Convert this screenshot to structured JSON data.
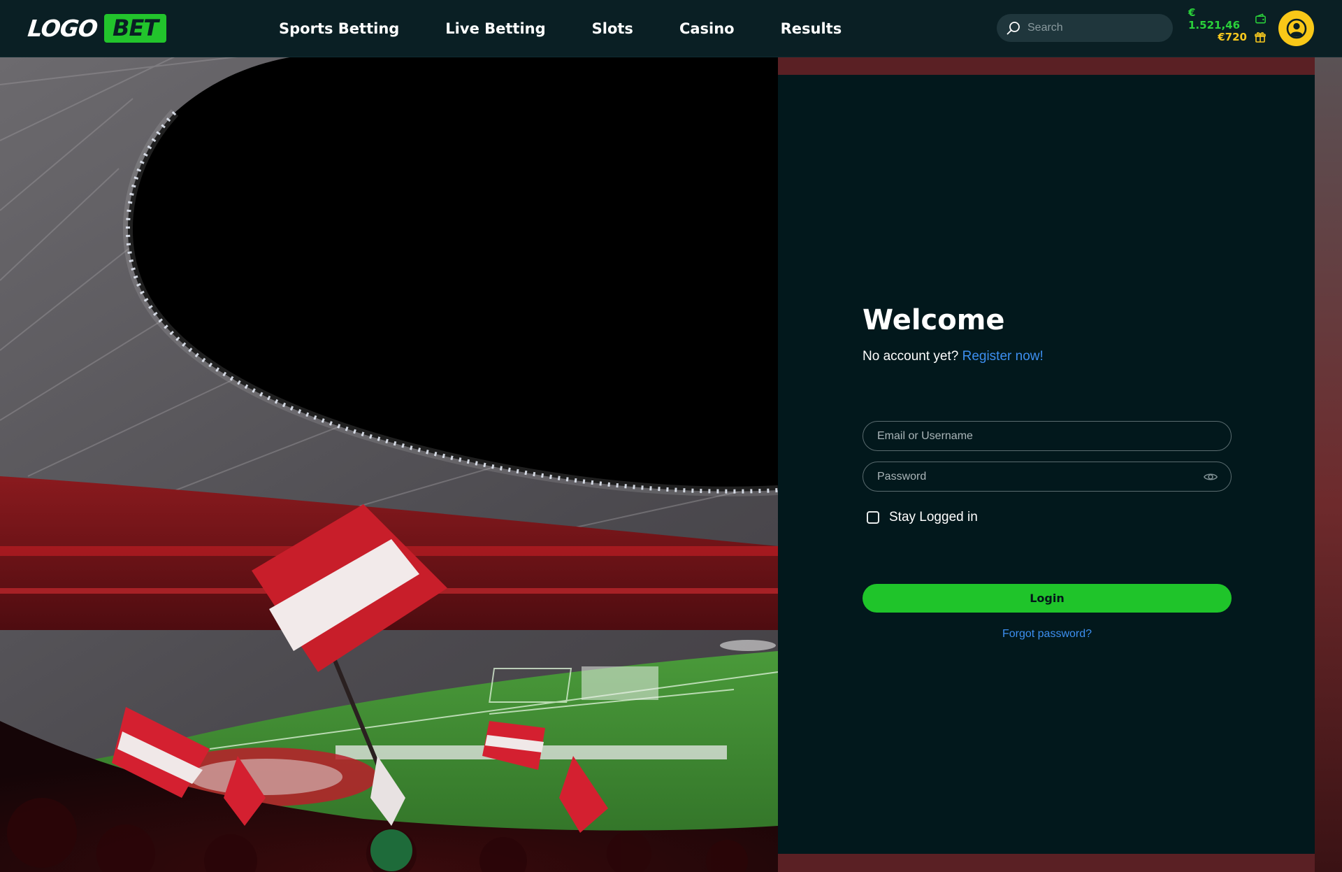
{
  "brand": {
    "logo_text": "LOGO",
    "logo_badge": "BET"
  },
  "nav": {
    "items": [
      {
        "label": "Sports Betting"
      },
      {
        "label": "Live Betting"
      },
      {
        "label": "Slots"
      },
      {
        "label": "Casino"
      },
      {
        "label": "Results"
      }
    ]
  },
  "search": {
    "placeholder": "Search",
    "icon": "search-icon"
  },
  "wallet": {
    "balance": "€ 1.521,46",
    "balance_icon": "wallet-icon",
    "bonus": "€720",
    "bonus_icon": "gift-icon"
  },
  "account": {
    "icon": "user-icon"
  },
  "login": {
    "title": "Welcome",
    "no_account_text": "No account yet?",
    "register_link": "Register now!",
    "email_placeholder": "Email or Username",
    "password_placeholder": "Password",
    "password_toggle_icon": "eye-icon",
    "stay_logged_label": "Stay Logged in",
    "stay_logged_checked": false,
    "login_button": "Login",
    "forgot_link": "Forgot password?"
  },
  "colors": {
    "background": "#02181c",
    "topbar": "#0a1f24",
    "brand_green": "#1fc42a",
    "link_blue": "#3d8ff0",
    "accent_yellow": "#f9c818"
  }
}
